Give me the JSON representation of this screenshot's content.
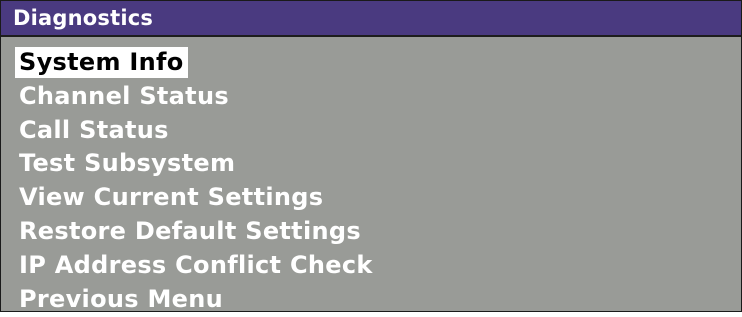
{
  "header": {
    "title": "Diagnostics"
  },
  "menu": {
    "selected_index": 0,
    "items": [
      {
        "label": "System Info"
      },
      {
        "label": "Channel Status"
      },
      {
        "label": "Call Status"
      },
      {
        "label": "Test Subsystem"
      },
      {
        "label": "View Current Settings"
      },
      {
        "label": "Restore Default Settings"
      },
      {
        "label": "IP Address Conflict Check"
      },
      {
        "label": "Previous Menu"
      }
    ]
  },
  "colors": {
    "title_bar": "#4a3a80",
    "panel": "#999b97",
    "text": "#ffffff",
    "highlight_bg": "#ffffff",
    "highlight_text": "#000000"
  }
}
